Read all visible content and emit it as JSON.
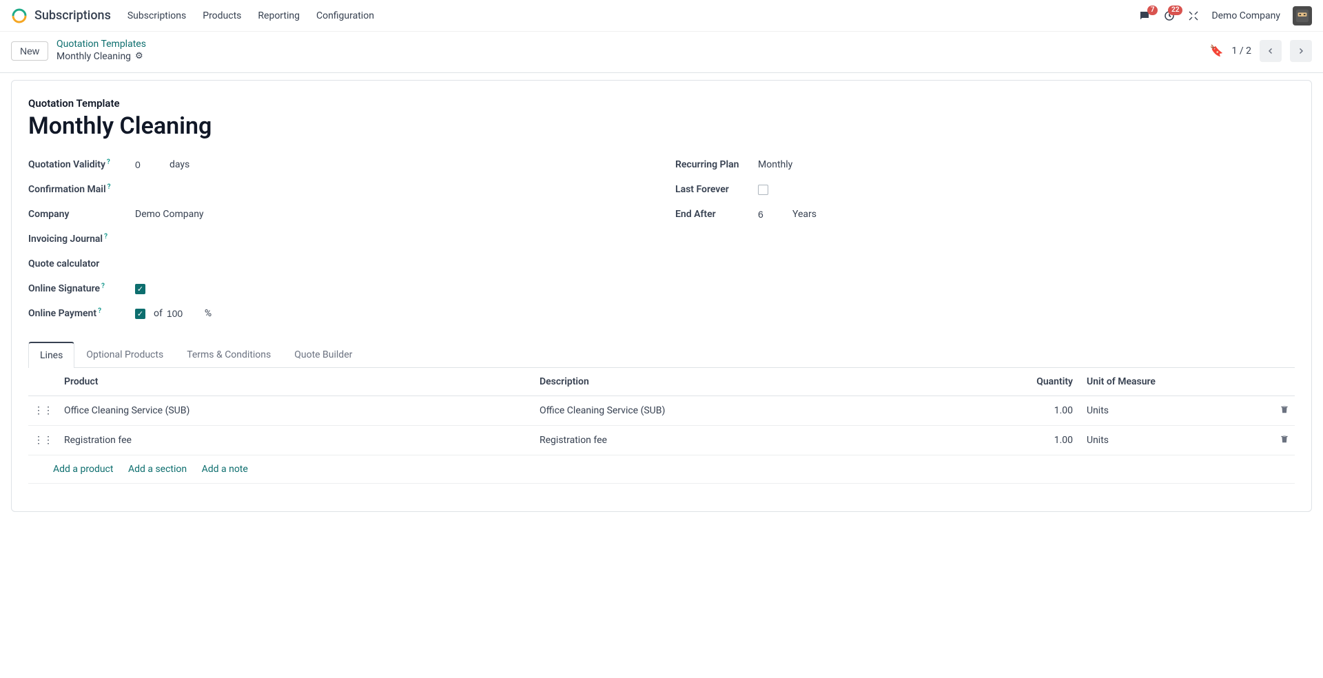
{
  "app": {
    "title": "Subscriptions",
    "nav": [
      "Subscriptions",
      "Products",
      "Reporting",
      "Configuration"
    ],
    "chat_badge": "7",
    "activity_badge": "22",
    "company": "Demo Company"
  },
  "toolbar": {
    "new_label": "New",
    "breadcrumb_parent": "Quotation Templates",
    "breadcrumb_current": "Monthly Cleaning",
    "pager": "1 / 2"
  },
  "record": {
    "title_label": "Quotation Template",
    "title": "Monthly Cleaning",
    "left": {
      "quotation_validity_label": "Quotation Validity",
      "quotation_validity_value": "0",
      "quotation_validity_unit": "days",
      "confirmation_mail_label": "Confirmation Mail",
      "company_label": "Company",
      "company_value": "Demo Company",
      "invoicing_journal_label": "Invoicing Journal",
      "quote_calculator_label": "Quote calculator",
      "online_signature_label": "Online Signature",
      "online_signature_checked": true,
      "online_payment_label": "Online Payment",
      "online_payment_checked": true,
      "online_payment_of": "of",
      "online_payment_value": "100",
      "online_payment_unit": "%"
    },
    "right": {
      "recurring_plan_label": "Recurring Plan",
      "recurring_plan_value": "Monthly",
      "last_forever_label": "Last Forever",
      "last_forever_checked": false,
      "end_after_label": "End After",
      "end_after_value": "6",
      "end_after_unit": "Years"
    }
  },
  "tabs": [
    "Lines",
    "Optional Products",
    "Terms & Conditions",
    "Quote Builder"
  ],
  "lines": {
    "headers": {
      "product": "Product",
      "description": "Description",
      "quantity": "Quantity",
      "uom": "Unit of Measure"
    },
    "rows": [
      {
        "product": "Office Cleaning Service (SUB)",
        "description": "Office Cleaning Service (SUB)",
        "quantity": "1.00",
        "uom": "Units"
      },
      {
        "product": "Registration fee",
        "description": "Registration fee",
        "quantity": "1.00",
        "uom": "Units"
      }
    ],
    "add_product": "Add a product",
    "add_section": "Add a section",
    "add_note": "Add a note"
  }
}
